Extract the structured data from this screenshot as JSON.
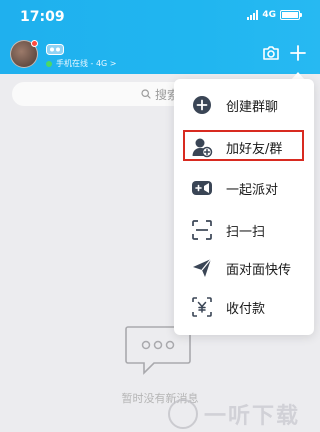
{
  "status_bar": {
    "time": "17:09",
    "network": "4G"
  },
  "header": {
    "online_status": "手机在线 - 4G >",
    "accent_color": "#1fb0ee"
  },
  "search": {
    "placeholder": "搜索"
  },
  "menu": {
    "items": [
      {
        "label": "创建群聊",
        "icon": "chat-plus-icon"
      },
      {
        "label": "加好友/群",
        "icon": "add-friend-icon",
        "highlighted": true
      },
      {
        "label": "一起派对",
        "icon": "party-icon"
      },
      {
        "label": "扫一扫",
        "icon": "scan-icon"
      },
      {
        "label": "面对面快传",
        "icon": "send-icon"
      },
      {
        "label": "收付款",
        "icon": "payment-icon"
      }
    ]
  },
  "empty_state": {
    "text": "暂时没有新消息"
  },
  "watermark": {
    "text": "一听下载"
  }
}
